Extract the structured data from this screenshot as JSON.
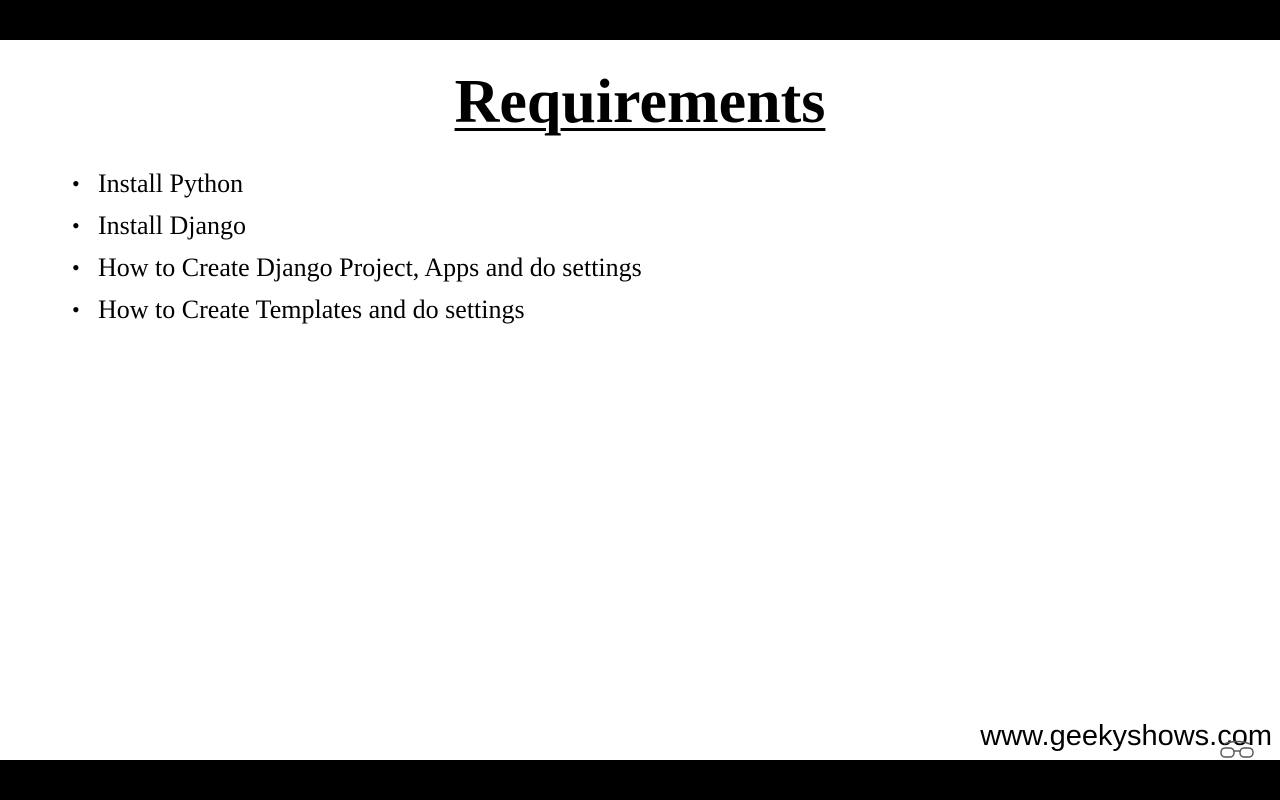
{
  "slide": {
    "title": "Requirements",
    "bullets": [
      {
        "text": "Install Python"
      },
      {
        "text": "Install Django"
      },
      {
        "text": "How to Create Django Project, Apps and do settings"
      },
      {
        "text": "How to Create Templates and do settings"
      }
    ],
    "bullet_glyph": "•",
    "watermark": "www.geekyshows.com"
  },
  "colors": {
    "background": "#ffffff",
    "letterbox": "#000000",
    "text": "#000000"
  }
}
